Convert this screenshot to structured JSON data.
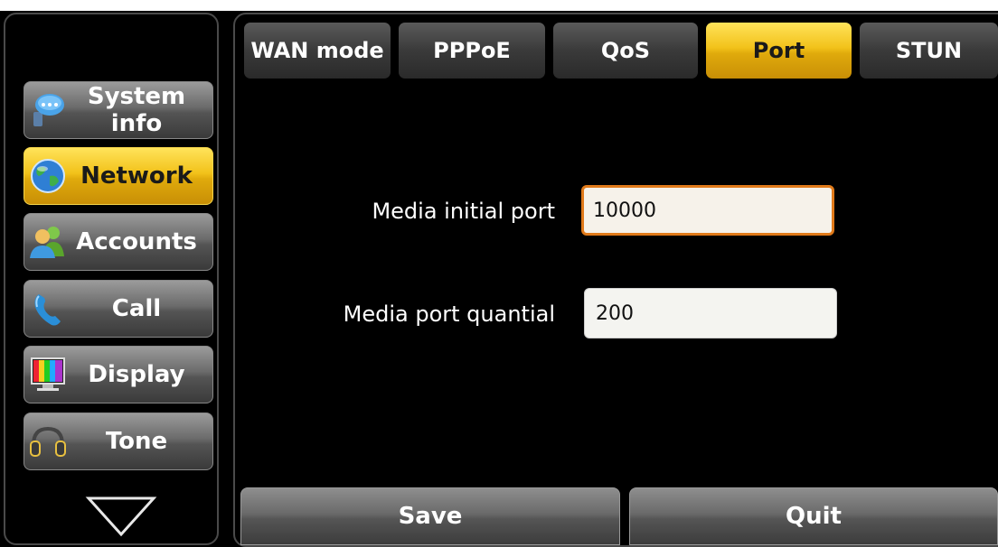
{
  "sidebar": {
    "items": [
      {
        "label": "System info",
        "icon": "chat-bubble-icon",
        "active": false
      },
      {
        "label": "Network",
        "icon": "globe-icon",
        "active": true
      },
      {
        "label": "Accounts",
        "icon": "users-icon",
        "active": false
      },
      {
        "label": "Call",
        "icon": "phone-handset-icon",
        "active": false
      },
      {
        "label": "Display",
        "icon": "monitor-icon",
        "active": false
      },
      {
        "label": "Tone",
        "icon": "headphones-icon",
        "active": false
      }
    ],
    "more_icon": "triangle-down-icon"
  },
  "tabs": [
    {
      "label": "WAN mode",
      "active": false
    },
    {
      "label": "PPPoE",
      "active": false
    },
    {
      "label": "QoS",
      "active": false
    },
    {
      "label": "Port",
      "active": true
    },
    {
      "label": "STUN",
      "active": false
    }
  ],
  "form": {
    "media_initial_port": {
      "label": "Media initial port",
      "value": "10000"
    },
    "media_port_quantial": {
      "label": "Media port quantial",
      "value": "200"
    }
  },
  "actions": {
    "save_label": "Save",
    "quit_label": "Quit"
  },
  "colors": {
    "accent": "#f2c21a",
    "focus_border": "#e07a1a",
    "background": "#000000"
  }
}
